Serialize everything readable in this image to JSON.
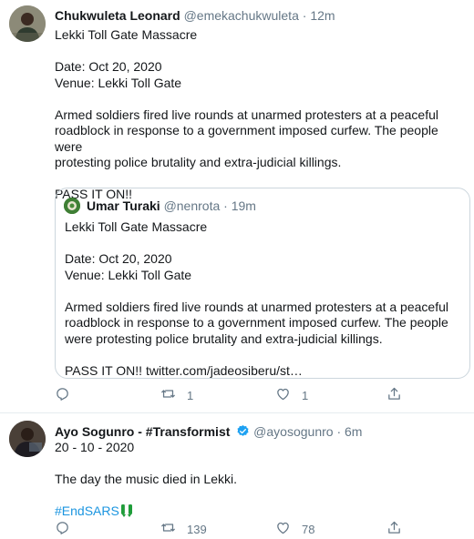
{
  "tweets": [
    {
      "name": "Chukwuleta Leonard",
      "handle": "@emekachukwuleta",
      "sep": "·",
      "time": "12m",
      "lines": [
        "Lekki Toll Gate Massacre",
        "",
        "Date: Oct 20, 2020",
        "Venue: Lekki Toll Gate",
        "",
        "Armed soldiers fired live rounds at unarmed protesters at a peaceful",
        "roadblock in response to a government imposed curfew. The people were",
        "protesting police brutality and extra-judicial killings.",
        "",
        "PASS IT ON!!"
      ],
      "quote": {
        "name": "Umar Turaki",
        "handle": "@nenrota",
        "sep": "·",
        "time": "19m",
        "lines": [
          "Lekki Toll Gate Massacre",
          "",
          "Date: Oct 20, 2020",
          "Venue: Lekki Toll Gate",
          "",
          "Armed soldiers fired live rounds at unarmed protesters at a peaceful",
          "roadblock in response to a government imposed curfew. The people",
          "were protesting police brutality and extra-judicial killings.",
          "",
          "PASS IT ON!! twitter.com/jadeosiberu/st…"
        ]
      },
      "actions": {
        "reply": "",
        "retweet": "1",
        "like": "1",
        "share": ""
      }
    },
    {
      "name": "Ayo Sogunro - #Transformist",
      "handle": "@ayosogunro",
      "sep": "·",
      "time": "6m",
      "verified": true,
      "lines": [
        "20 - 10 - 2020",
        "",
        "The day the music died in Lekki.",
        ""
      ],
      "hashtag": "#EndSARS",
      "actions": {
        "reply": "",
        "retweet": "139",
        "like": "78",
        "share": ""
      }
    }
  ],
  "colors": {
    "text": "#14171a",
    "muted": "#657786",
    "link": "#1b95e0",
    "border": "#e6ecf0",
    "verified": "#1da1f2"
  },
  "icons": [
    "reply-icon",
    "retweet-icon",
    "like-icon",
    "share-icon",
    "verified-icon",
    "green-white-green-ribbon"
  ]
}
